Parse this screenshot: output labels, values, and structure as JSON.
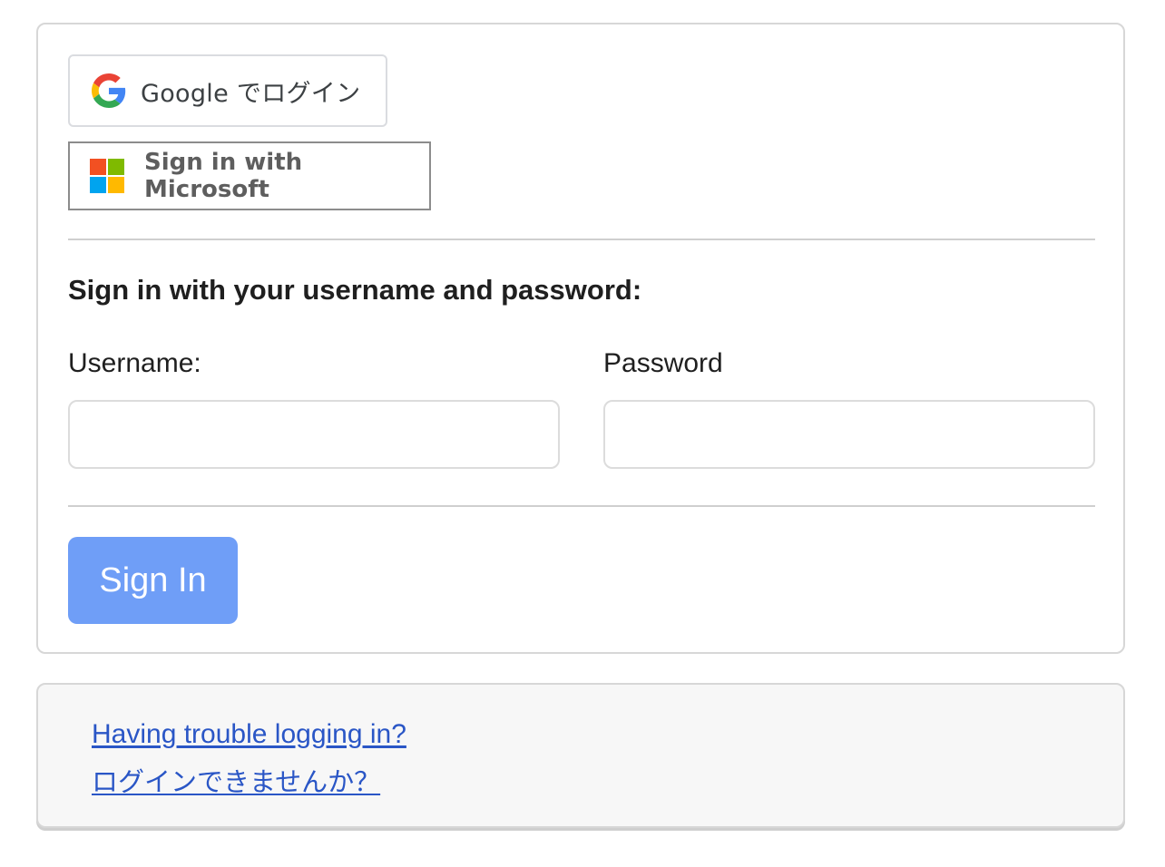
{
  "sso": {
    "google_label": "Google でログイン",
    "microsoft_label": "Sign in with Microsoft"
  },
  "form": {
    "heading": "Sign in with your username and password:",
    "username_label": "Username:",
    "password_label": "Password",
    "username_value": "",
    "password_value": "",
    "submit_label": "Sign In"
  },
  "help": {
    "trouble_en": "Having trouble logging in?",
    "trouble_ja": "ログインできませんか？"
  },
  "colors": {
    "submit_bg": "#6f9ef7",
    "link": "#2a56c6",
    "google_blue": "#4285F4",
    "google_red": "#EA4335",
    "google_yellow": "#FBBC05",
    "google_green": "#34A853",
    "ms_red": "#F25022",
    "ms_green": "#7FBA00",
    "ms_blue": "#00A4EF",
    "ms_yellow": "#FFB900"
  },
  "icons": {
    "google": "google-logo-icon",
    "microsoft": "microsoft-logo-icon"
  }
}
